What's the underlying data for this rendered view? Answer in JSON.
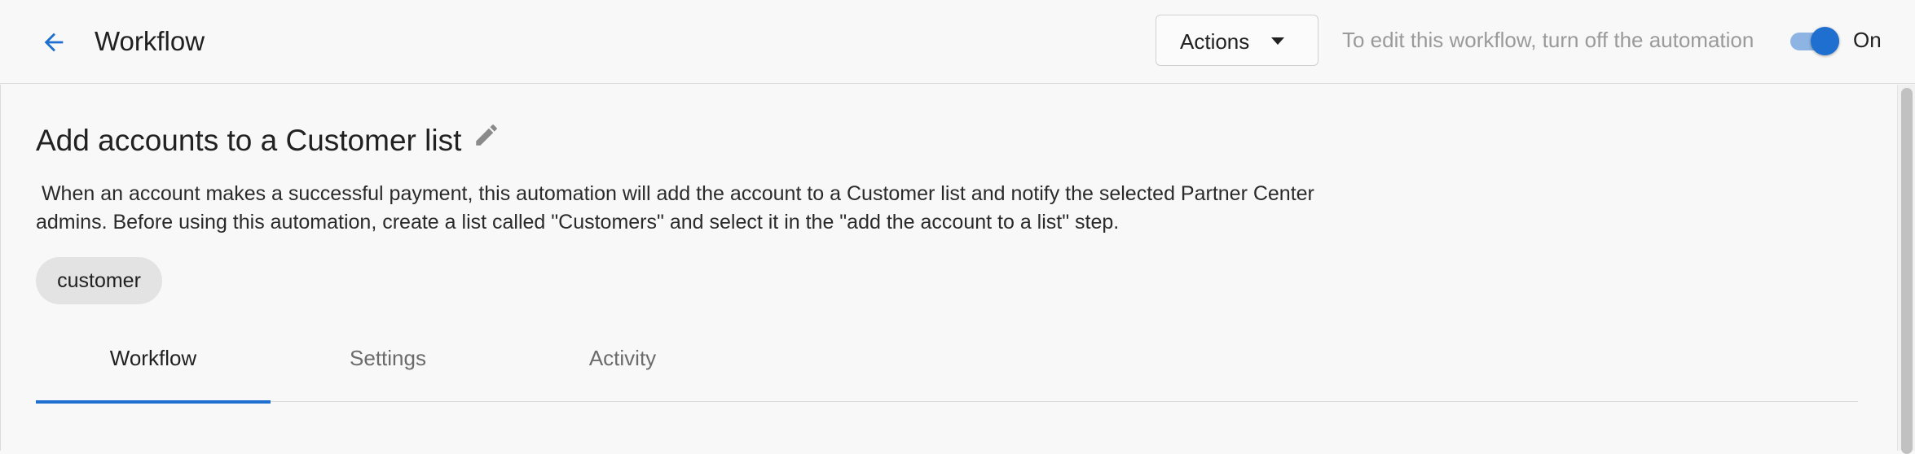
{
  "header": {
    "title": "Workflow",
    "back_icon": "arrow-left-icon",
    "actions_label": "Actions",
    "edit_hint": "To edit this workflow, turn off the automation",
    "toggle_label": "On",
    "toggle_on": true,
    "accent_color": "#1e6fd0"
  },
  "workflow": {
    "title": "Add accounts to a Customer list",
    "description": " When an account makes a successful payment, this automation will add the account to a Customer list and notify the selected Partner Center\nadmins. Before using this automation, create a list called \"Customers\" and select it in the \"add the account to a list\" step.",
    "tags": [
      "customer"
    ]
  },
  "tabs": [
    {
      "label": "Workflow",
      "active": true
    },
    {
      "label": "Settings",
      "active": false
    },
    {
      "label": "Activity",
      "active": false
    }
  ]
}
